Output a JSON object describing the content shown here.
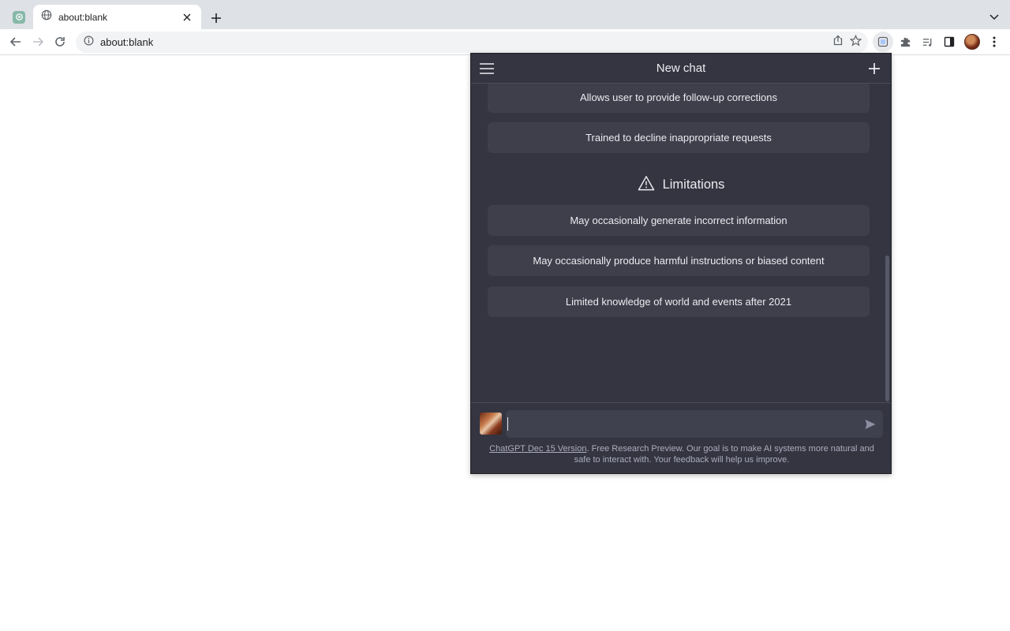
{
  "browser": {
    "tab_title": "about:blank",
    "url": "about:blank"
  },
  "popup": {
    "title": "New chat",
    "capabilities_visible": [
      "Allows user to provide follow-up corrections",
      "Trained to decline inappropriate requests"
    ],
    "limitations_heading": "Limitations",
    "limitations": [
      "May occasionally generate incorrect information",
      "May occasionally produce harmful instructions or biased content",
      "Limited knowledge of world and events after 2021"
    ],
    "input": {
      "value": "",
      "placeholder": ""
    },
    "footer": {
      "link_text": "ChatGPT Dec 15 Version",
      "text": ". Free Research Preview. Our goal is to make AI systems more natural and safe to interact with. Your feedback will help us improve."
    }
  },
  "colors": {
    "popup_bg": "#343541",
    "card_bg": "#3e3f4b",
    "input_bg": "#40414f",
    "text": "#ececf1",
    "muted_text": "#acacbe",
    "chrome_tabstrip": "#dee1e6"
  },
  "icons": {
    "pinned_tab": "chatgpt-icon",
    "tab_favicon": "globe-icon",
    "limitations": "warning-icon",
    "menu": "hamburger-icon",
    "new_chat": "plus-icon",
    "send": "send-icon"
  }
}
